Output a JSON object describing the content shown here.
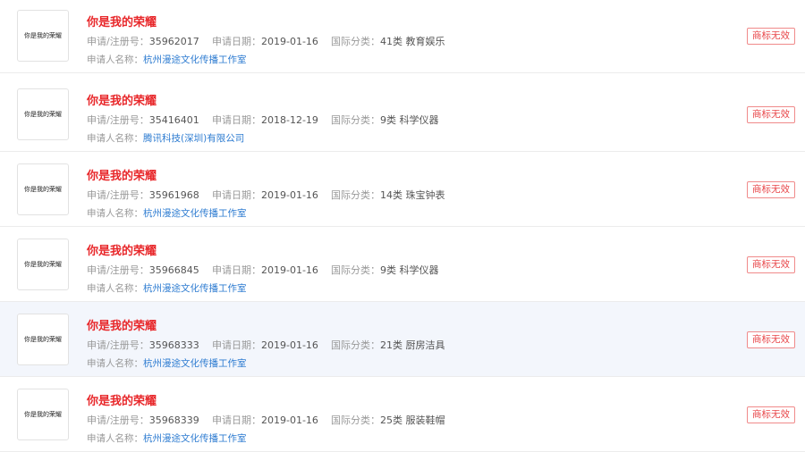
{
  "labels": {
    "reg_no": "申请/注册号：",
    "apply_date": "申请日期：",
    "intl_class": "国际分类：",
    "applicant": "申请人名称："
  },
  "items": [
    {
      "thumb_text": "你是我的荣耀",
      "title": "你是我的荣耀",
      "reg_no": "35962017",
      "apply_date": "2019-01-16",
      "intl_class": "41类 教育娱乐",
      "applicant": "杭州漫途文化传播工作室",
      "status": "商标无效"
    },
    {
      "thumb_text": "你是我的荣耀",
      "title": "你是我的荣耀",
      "reg_no": "35416401",
      "apply_date": "2018-12-19",
      "intl_class": "9类 科学仪器",
      "applicant": "腾讯科技(深圳)有限公司",
      "status": "商标无效"
    },
    {
      "thumb_text": "你是我的荣耀",
      "title": "你是我的荣耀",
      "reg_no": "35961968",
      "apply_date": "2019-01-16",
      "intl_class": "14类 珠宝钟表",
      "applicant": "杭州漫途文化传播工作室",
      "status": "商标无效"
    },
    {
      "thumb_text": "你是我的荣耀",
      "title": "你是我的荣耀",
      "reg_no": "35966845",
      "apply_date": "2019-01-16",
      "intl_class": "9类 科学仪器",
      "applicant": "杭州漫途文化传播工作室",
      "status": "商标无效"
    },
    {
      "thumb_text": "你是我的荣耀",
      "title": "你是我的荣耀",
      "reg_no": "35968333",
      "apply_date": "2019-01-16",
      "intl_class": "21类 厨房洁具",
      "applicant": "杭州漫途文化传播工作室",
      "status": "商标无效"
    },
    {
      "thumb_text": "你是我的荣耀",
      "title": "你是我的荣耀",
      "reg_no": "35968339",
      "apply_date": "2019-01-16",
      "intl_class": "25类 服装鞋帽",
      "applicant": "杭州漫途文化传播工作室",
      "status": "商标无效"
    }
  ],
  "colors": {
    "title": "#e8282b",
    "link": "#2e7cd1",
    "status_border": "#f08a8a",
    "hover_row_bg": "#f3f6fc"
  }
}
